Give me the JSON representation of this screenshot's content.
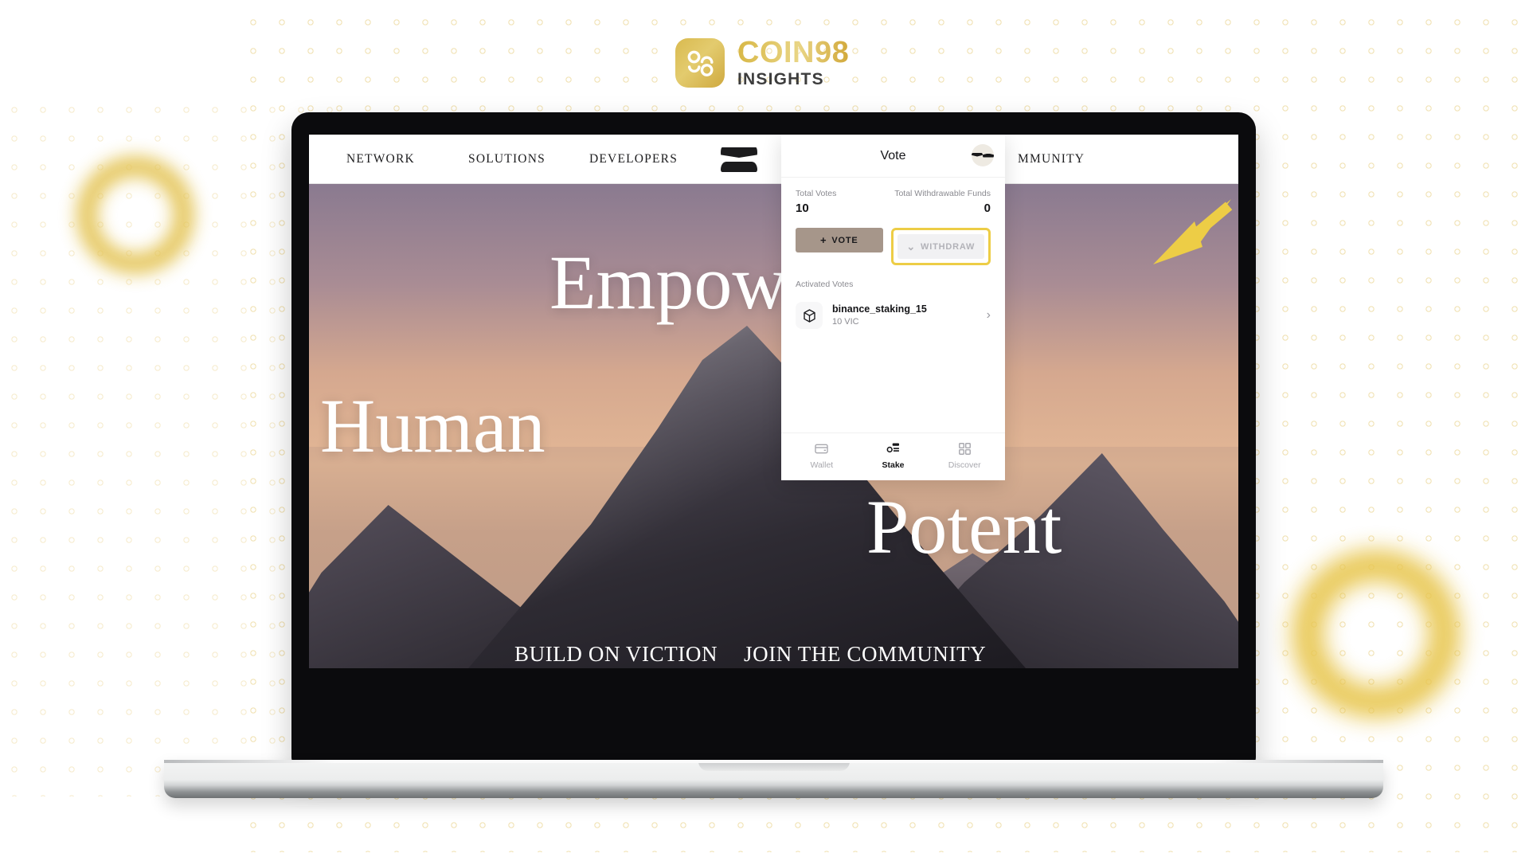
{
  "brand": {
    "mark_icon": "coin98-logo-icon",
    "title": "COIN98",
    "subtitle": "INSIGHTS"
  },
  "website": {
    "nav": {
      "items": [
        {
          "label": "NETWORK"
        },
        {
          "label": "SOLUTIONS"
        },
        {
          "label": "DEVELOPERS"
        },
        {
          "label": "MMUNITY"
        }
      ],
      "logo_icon": "viction-logo-icon"
    },
    "hero": {
      "words": [
        "Empower",
        "Human",
        "Potent"
      ],
      "cta_left": "BUILD ON VICTION",
      "cta_right": "JOIN THE COMMUNITY"
    }
  },
  "wallet": {
    "header": {
      "title": "Vote",
      "avatar_icon": "viction-avatar-icon"
    },
    "stats": [
      {
        "label": "Total Votes",
        "value": "10"
      },
      {
        "label": "Total Withdrawable Funds",
        "value": "0"
      }
    ],
    "buttons": {
      "vote": {
        "label": "VOTE",
        "icon": "plus-icon"
      },
      "withdraw": {
        "label": "WITHDRAW",
        "icon": "chevron-down-icon",
        "disabled": true,
        "highlighted": true
      }
    },
    "section_label": "Activated Votes",
    "votes": [
      {
        "icon": "cube-icon",
        "name": "binance_staking_15",
        "amount": "10 VIC",
        "chevron": "chevron-right-icon"
      }
    ],
    "tabs": [
      {
        "label": "Wallet",
        "icon": "wallet-card-icon",
        "active": false
      },
      {
        "label": "Stake",
        "icon": "stake-icon",
        "active": true
      },
      {
        "label": "Discover",
        "icon": "grid-icon",
        "active": false
      }
    ]
  },
  "annotation": {
    "arrow_icon": "pointer-arrow-icon",
    "arrow_color": "#edcd46",
    "highlight_color": "#edcd46"
  },
  "decor": {
    "ring_color": "#e4c455",
    "dot_color": "#f0dfae"
  }
}
